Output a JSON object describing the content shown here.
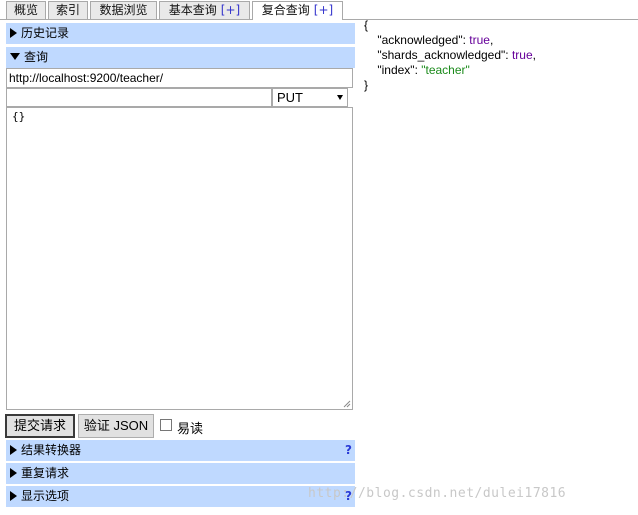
{
  "tabs": [
    {
      "label": "概览"
    },
    {
      "label": "索引"
    },
    {
      "label": "数据浏览"
    },
    {
      "label": "基本查询",
      "plus": "[+]"
    },
    {
      "label": "复合查询",
      "plus": "[+]"
    }
  ],
  "sections": {
    "history": "历史记录",
    "query": "查询",
    "result_transform": "结果转换器",
    "repeat": "重复请求",
    "display_options": "显示选项",
    "help": "?"
  },
  "request": {
    "url": "http://localhost:9200/teacher/",
    "path": "",
    "method": "PUT",
    "body": "{}"
  },
  "buttons": {
    "submit": "提交请求",
    "validate": "验证 JSON",
    "readonly_label": "易读"
  },
  "response": {
    "open": "{",
    "close": "}",
    "lines": [
      {
        "key": "\"acknowledged\"",
        "value": "true",
        "type": "bool",
        "comma": ","
      },
      {
        "key": "\"shards_acknowledged\"",
        "value": "true",
        "type": "bool",
        "comma": ","
      },
      {
        "key": "\"index\"",
        "value": "\"teacher\"",
        "type": "string",
        "comma": ""
      }
    ]
  },
  "watermark": "http://blog.csdn.net/dulei17816",
  "colors": {
    "bar": "#bfd9ff",
    "bool": "#660099",
    "string": "#1a8a1a",
    "help": "#2b3bd6"
  }
}
